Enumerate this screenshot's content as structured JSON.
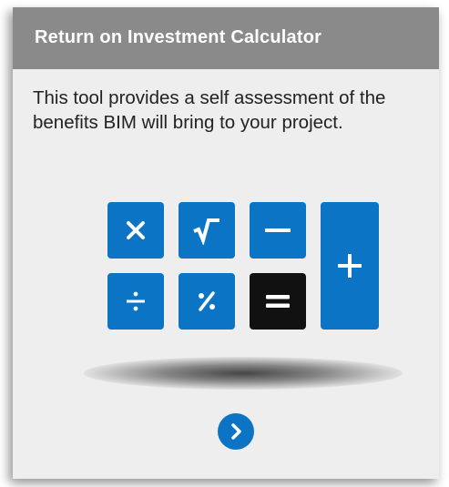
{
  "card": {
    "title": "Return on Investment Calculator",
    "description": "This tool provides a self assessment of the benefits BIM will bring to your project."
  },
  "calculator_icon": {
    "keys": [
      "multiply",
      "square-root",
      "minus",
      "plus",
      "divide",
      "percent",
      "equals"
    ],
    "accent_color": "#0b74c4",
    "equals_key_color": "#111111"
  },
  "navigation": {
    "next_icon": "chevron-right-icon"
  }
}
